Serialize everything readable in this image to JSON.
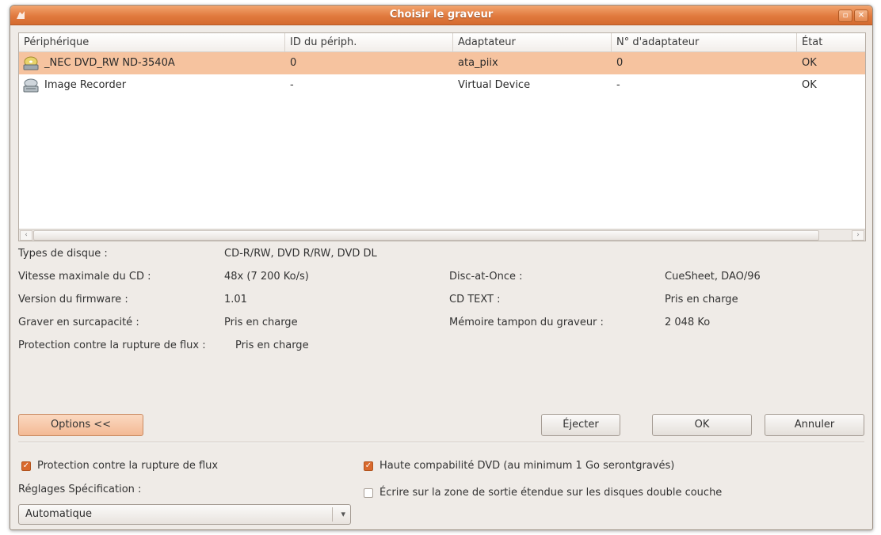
{
  "window": {
    "title": "Choisir le graveur",
    "controls": {
      "restore": "▫",
      "close": "✕"
    }
  },
  "columns": [
    "Périphérique",
    "ID du périph.",
    "Adaptateur",
    "N° d'adaptateur",
    "État"
  ],
  "devices": [
    {
      "name": "_NEC    DVD_RW ND-3540A",
      "id": "0",
      "adapter": "ata_piix",
      "adapter_no": "0",
      "state": "OK",
      "icon": "optical-drive-icon",
      "selected": true
    },
    {
      "name": "Image Recorder",
      "id": "-",
      "adapter": "Virtual Device",
      "adapter_no": "-",
      "state": "OK",
      "icon": "image-recorder-icon",
      "selected": false
    }
  ],
  "info_left": [
    {
      "label": "Types de disque :",
      "value": "CD-R/RW, DVD R/RW, DVD DL"
    },
    {
      "label": "Vitesse maximale du CD :",
      "value": "48x (7 200 Ko/s)"
    },
    {
      "label": "Version du firmware :",
      "value": "1.01"
    },
    {
      "label": "Graver en surcapacité :",
      "value": "Pris en charge"
    },
    {
      "label": "Protection contre la rupture de flux :",
      "value": "Pris en charge"
    }
  ],
  "info_right": [
    {
      "label": "Disc-at-Once :",
      "value": "CueSheet, DAO/96"
    },
    {
      "label": "CD TEXT :",
      "value": "Pris en charge"
    },
    {
      "label": "Mémoire tampon du graveur :",
      "value": "2 048 Ko"
    }
  ],
  "buttons": {
    "options": "Options <<",
    "eject": "Éjecter",
    "ok": "OK",
    "cancel": "Annuler"
  },
  "options": {
    "buffer_protection": {
      "label": "Protection contre la rupture de flux",
      "checked": true
    },
    "spec_label": "Réglages Spécification :",
    "spec_value": "Automatique",
    "dvd_compat": {
      "label": "Haute compabilité DVD (au minimum 1 Go serontgravés)",
      "checked": true
    },
    "extended_leadout": {
      "label": "Écrire sur la zone de sortie étendue sur les disques double couche",
      "checked": false
    }
  },
  "colors": {
    "accent": "#e17a3e",
    "selection": "#f6c39f"
  }
}
